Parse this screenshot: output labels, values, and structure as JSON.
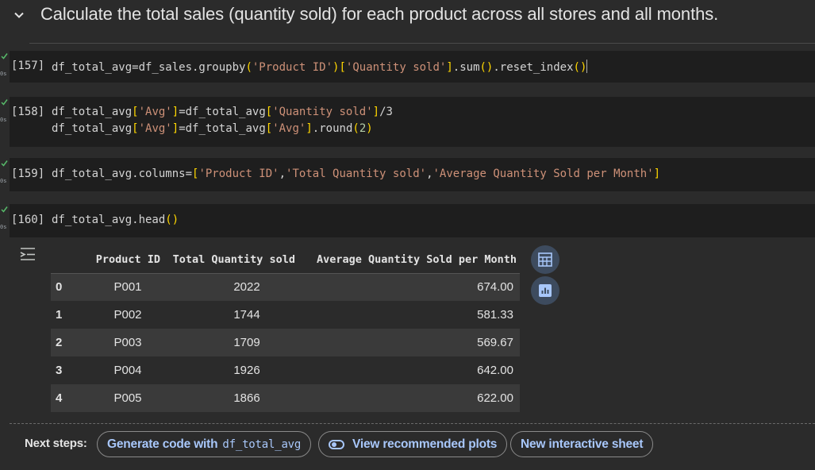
{
  "section": {
    "title": "Calculate the total sales (quantity sold) for each product across all stores and all months."
  },
  "cells": [
    {
      "exec_count": "[157]",
      "lines": [
        [
          {
            "t": "df_total_avg=df_sales.groupby",
            "c": "id"
          },
          {
            "t": "(",
            "c": "punc"
          },
          {
            "t": "'Product ID'",
            "c": "str"
          },
          {
            "t": ")",
            "c": "punc"
          },
          {
            "t": "[",
            "c": "punc"
          },
          {
            "t": "'Quantity sold'",
            "c": "str"
          },
          {
            "t": "]",
            "c": "punc"
          },
          {
            "t": ".sum",
            "c": "id"
          },
          {
            "t": "()",
            "c": "punc"
          },
          {
            "t": ".reset_index",
            "c": "id"
          },
          {
            "t": "()",
            "c": "punc"
          }
        ]
      ]
    },
    {
      "exec_count": "[158]",
      "lines": [
        [
          {
            "t": "df_total_avg",
            "c": "id"
          },
          {
            "t": "[",
            "c": "punc"
          },
          {
            "t": "'Avg'",
            "c": "str"
          },
          {
            "t": "]",
            "c": "punc"
          },
          {
            "t": "=df_total_avg",
            "c": "id"
          },
          {
            "t": "[",
            "c": "punc"
          },
          {
            "t": "'Quantity sold'",
            "c": "str"
          },
          {
            "t": "]",
            "c": "punc"
          },
          {
            "t": "/3",
            "c": "id"
          }
        ],
        [
          {
            "t": "df_total_avg",
            "c": "id"
          },
          {
            "t": "[",
            "c": "punc"
          },
          {
            "t": "'Avg'",
            "c": "str"
          },
          {
            "t": "]",
            "c": "punc"
          },
          {
            "t": "=df_total_avg",
            "c": "id"
          },
          {
            "t": "[",
            "c": "punc"
          },
          {
            "t": "'Avg'",
            "c": "str"
          },
          {
            "t": "]",
            "c": "punc"
          },
          {
            "t": ".round",
            "c": "id"
          },
          {
            "t": "(",
            "c": "punc"
          },
          {
            "t": "2",
            "c": "num"
          },
          {
            "t": ")",
            "c": "punc"
          }
        ]
      ]
    },
    {
      "exec_count": "[159]",
      "lines": [
        [
          {
            "t": "df_total_avg.columns=",
            "c": "id"
          },
          {
            "t": "[",
            "c": "punc"
          },
          {
            "t": "'Product ID'",
            "c": "str"
          },
          {
            "t": ",",
            "c": "id"
          },
          {
            "t": "'Total Quantity sold'",
            "c": "str"
          },
          {
            "t": ",",
            "c": "id"
          },
          {
            "t": "'Average Quantity Sold per Month'",
            "c": "str"
          },
          {
            "t": "]",
            "c": "punc"
          }
        ]
      ]
    },
    {
      "exec_count": "[160]",
      "lines": [
        [
          {
            "t": "df_total_avg.head",
            "c": "id"
          },
          {
            "t": "()",
            "c": "punc"
          }
        ]
      ]
    }
  ],
  "gutter_tick": "0s",
  "table": {
    "columns": [
      "",
      "Product ID",
      "Total Quantity sold",
      "Average Quantity Sold per Month"
    ],
    "rows": [
      [
        "0",
        "P001",
        "2022",
        "674.00"
      ],
      [
        "1",
        "P002",
        "1744",
        "581.33"
      ],
      [
        "2",
        "P003",
        "1709",
        "569.67"
      ],
      [
        "3",
        "P004",
        "1926",
        "642.00"
      ],
      [
        "4",
        "P005",
        "1866",
        "622.00"
      ]
    ]
  },
  "next_steps": {
    "label": "Next steps:",
    "generate_prefix": "Generate code with",
    "generate_var": "df_total_avg",
    "plots": "View recommended plots",
    "sheet": "New interactive sheet"
  },
  "colors": {
    "string": "#ce9178",
    "bracket": "#ffd700",
    "link": "#a8c7fa"
  }
}
